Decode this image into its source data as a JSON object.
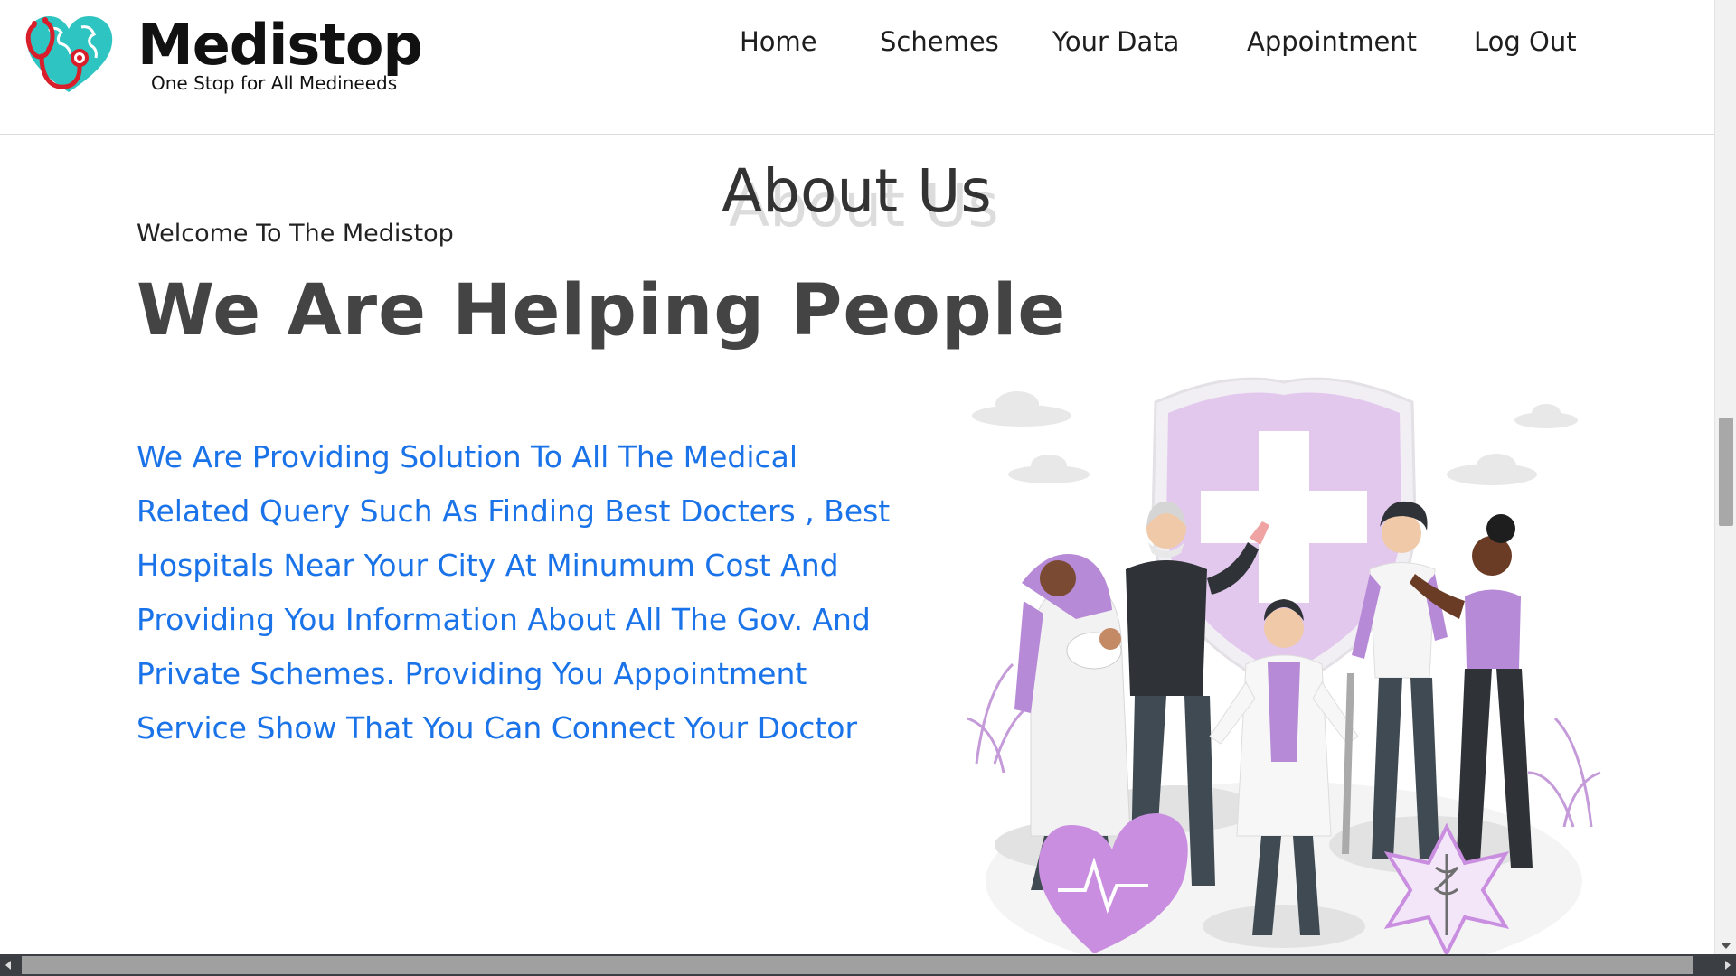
{
  "header": {
    "brand": {
      "title": "Medistop",
      "tagline": "One Stop for All Medineeds"
    },
    "nav": [
      {
        "label": "Home"
      },
      {
        "label": "Schemes"
      },
      {
        "label": "Your Data"
      },
      {
        "label": "Appointment"
      },
      {
        "label": "Log Out"
      }
    ]
  },
  "main": {
    "section_title": "About Us",
    "welcome": "Welcome To The Medistop",
    "headline": "We Are Helping People",
    "description_lines": [
      "We Are Providing Solution To All The Medical",
      "Related Query Such As Finding Best Docters , Best",
      "Hospitals Near Your City At Minumum Cost And",
      "Providing You Information About All The Gov. And",
      "Private Schemes. Providing You Appointment",
      "Service Show That You Can Connect Your Doctor"
    ]
  },
  "colors": {
    "accent_blue": "#1a73e8",
    "brand_teal": "#2ec4c1",
    "brand_red": "#d81e2a",
    "illustration_purple": "#b68ad6"
  }
}
